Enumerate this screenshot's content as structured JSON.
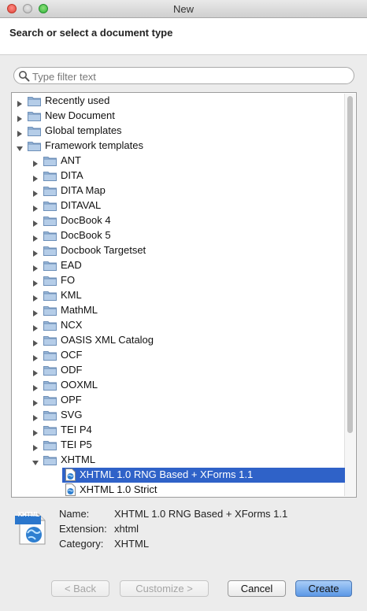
{
  "window": {
    "title": "New"
  },
  "header": {
    "title": "Search or select a document type"
  },
  "filter": {
    "placeholder": "Type filter text",
    "value": ""
  },
  "tree": {
    "items": [
      {
        "label": "Recently used",
        "level": 0,
        "kind": "folder",
        "expanded": false
      },
      {
        "label": "New Document",
        "level": 0,
        "kind": "folder",
        "expanded": false
      },
      {
        "label": "Global templates",
        "level": 0,
        "kind": "folder",
        "expanded": false
      },
      {
        "label": "Framework templates",
        "level": 0,
        "kind": "folder",
        "expanded": true
      },
      {
        "label": "ANT",
        "level": 1,
        "kind": "folder",
        "expanded": false
      },
      {
        "label": "DITA",
        "level": 1,
        "kind": "folder",
        "expanded": false
      },
      {
        "label": "DITA Map",
        "level": 1,
        "kind": "folder",
        "expanded": false
      },
      {
        "label": "DITAVAL",
        "level": 1,
        "kind": "folder",
        "expanded": false
      },
      {
        "label": "DocBook 4",
        "level": 1,
        "kind": "folder",
        "expanded": false
      },
      {
        "label": "DocBook 5",
        "level": 1,
        "kind": "folder",
        "expanded": false
      },
      {
        "label": "Docbook Targetset",
        "level": 1,
        "kind": "folder",
        "expanded": false
      },
      {
        "label": "EAD",
        "level": 1,
        "kind": "folder",
        "expanded": false
      },
      {
        "label": "FO",
        "level": 1,
        "kind": "folder",
        "expanded": false
      },
      {
        "label": "KML",
        "level": 1,
        "kind": "folder",
        "expanded": false
      },
      {
        "label": "MathML",
        "level": 1,
        "kind": "folder",
        "expanded": false
      },
      {
        "label": "NCX",
        "level": 1,
        "kind": "folder",
        "expanded": false
      },
      {
        "label": "OASIS XML Catalog",
        "level": 1,
        "kind": "folder",
        "expanded": false
      },
      {
        "label": "OCF",
        "level": 1,
        "kind": "folder",
        "expanded": false
      },
      {
        "label": "ODF",
        "level": 1,
        "kind": "folder",
        "expanded": false
      },
      {
        "label": "OOXML",
        "level": 1,
        "kind": "folder",
        "expanded": false
      },
      {
        "label": "OPF",
        "level": 1,
        "kind": "folder",
        "expanded": false
      },
      {
        "label": "SVG",
        "level": 1,
        "kind": "folder",
        "expanded": false
      },
      {
        "label": "TEI P4",
        "level": 1,
        "kind": "folder",
        "expanded": false
      },
      {
        "label": "TEI P5",
        "level": 1,
        "kind": "folder",
        "expanded": false
      },
      {
        "label": "XHTML",
        "level": 1,
        "kind": "folder",
        "expanded": true
      },
      {
        "label": "XHTML 1.0 RNG Based + XForms 1.1",
        "level": 2,
        "kind": "file",
        "selected": true
      },
      {
        "label": "XHTML 1.0 Strict",
        "level": 2,
        "kind": "file",
        "selected": false
      }
    ]
  },
  "details": {
    "icon_badge": "XHTML",
    "name_label": "Name:",
    "name_value": "XHTML 1.0 RNG Based + XForms 1.1",
    "extension_label": "Extension:",
    "extension_value": "xhtml",
    "category_label": "Category:",
    "category_value": "XHTML"
  },
  "buttons": {
    "back": "< Back",
    "customize": "Customize >",
    "cancel": "Cancel",
    "create": "Create"
  }
}
